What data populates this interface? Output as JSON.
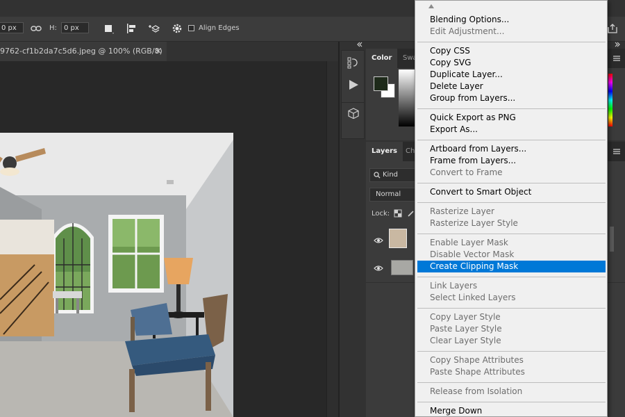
{
  "options_bar": {
    "w_value": "0 px",
    "h_label": "H:",
    "h_value": "0 px",
    "align_edges_label": "Align Edges"
  },
  "document": {
    "tab_title": "9762-cf1b2da7c5d6.jpeg @ 100% (RGB/8)",
    "close_glyph": "×"
  },
  "panels": {
    "color_tab": "Color",
    "swatches_tab": "Swa",
    "layers_tab": "Layers",
    "channels_tab": "Ch",
    "kind_filter": "Kind",
    "blend_mode": "Normal",
    "lock_label": "Lock:"
  },
  "context_menu": {
    "items": [
      {
        "label": "Blending Options...",
        "enabled": true
      },
      {
        "label": "Edit Adjustment...",
        "enabled": false
      },
      {
        "label": "Copy CSS",
        "enabled": true
      },
      {
        "label": "Copy SVG",
        "enabled": true
      },
      {
        "label": "Duplicate Layer...",
        "enabled": true
      },
      {
        "label": "Delete Layer",
        "enabled": true
      },
      {
        "label": "Group from Layers...",
        "enabled": true
      },
      {
        "label": "Quick Export as PNG",
        "enabled": true
      },
      {
        "label": "Export As...",
        "enabled": true
      },
      {
        "label": "Artboard from Layers...",
        "enabled": true
      },
      {
        "label": "Frame from Layers...",
        "enabled": true
      },
      {
        "label": "Convert to Frame",
        "enabled": false
      },
      {
        "label": "Convert to Smart Object",
        "enabled": true
      },
      {
        "label": "Rasterize Layer",
        "enabled": false
      },
      {
        "label": "Rasterize Layer Style",
        "enabled": false
      },
      {
        "label": "Enable Layer Mask",
        "enabled": false
      },
      {
        "label": "Disable Vector Mask",
        "enabled": false
      },
      {
        "label": "Create Clipping Mask",
        "enabled": true,
        "highlighted": true
      },
      {
        "label": "Link Layers",
        "enabled": false
      },
      {
        "label": "Select Linked Layers",
        "enabled": false
      },
      {
        "label": "Copy Layer Style",
        "enabled": false
      },
      {
        "label": "Paste Layer Style",
        "enabled": false
      },
      {
        "label": "Clear Layer Style",
        "enabled": false
      },
      {
        "label": "Copy Shape Attributes",
        "enabled": false
      },
      {
        "label": "Paste Shape Attributes",
        "enabled": false
      },
      {
        "label": "Release from Isolation",
        "enabled": false
      },
      {
        "label": "Merge Down",
        "enabled": true
      }
    ]
  },
  "colors": {
    "menu_highlight": "#0078d7",
    "foreground_swatch": "#1e2a1a",
    "background_swatch": "#ffffff"
  }
}
